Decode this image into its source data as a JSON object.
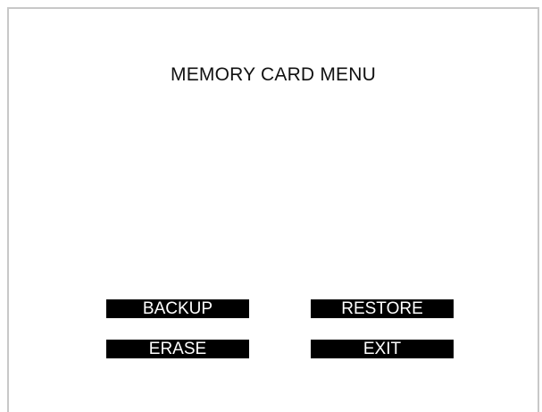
{
  "screen": {
    "title": "MEMORY CARD MENU"
  },
  "buttons": {
    "backup": "BACKUP",
    "restore": "RESTORE",
    "erase": "ERASE",
    "exit": "EXIT"
  },
  "colors": {
    "frame_border": "#c8c8c8",
    "button_background": "#000000",
    "button_text": "#ffffff",
    "title_text": "#111111"
  }
}
